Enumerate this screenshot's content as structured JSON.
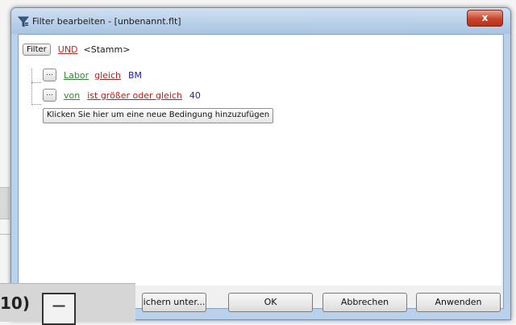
{
  "window": {
    "title": "Filter bearbeiten - [unbenannt.flt]",
    "close_glyph": "x"
  },
  "editor": {
    "root": {
      "filter_label": "Filter",
      "operator": "UND",
      "group_name": "<Stamm>"
    },
    "conditions": [
      {
        "dots": "...",
        "field": "Labor",
        "op": "gleich",
        "value": "BM"
      },
      {
        "dots": "...",
        "field": "von",
        "op": "ist größer oder gleich",
        "value": "40"
      }
    ],
    "add_condition_label": "Klicken Sie hier um eine neue Bedingung hinzuzufügen"
  },
  "buttons": {
    "save_as": "ichern unter...",
    "ok": "OK",
    "cancel": "Abbrechen",
    "apply": "Anwenden"
  },
  "background": {
    "partial_text": "10)",
    "box_glyph": "−"
  },
  "colors": {
    "operator": "#d2231d",
    "field": "#2e8b2e",
    "comparison": "#b2201d",
    "value": "#1f1fa0",
    "title_bar": "#b9d1ea",
    "close_button": "#c8452c"
  }
}
